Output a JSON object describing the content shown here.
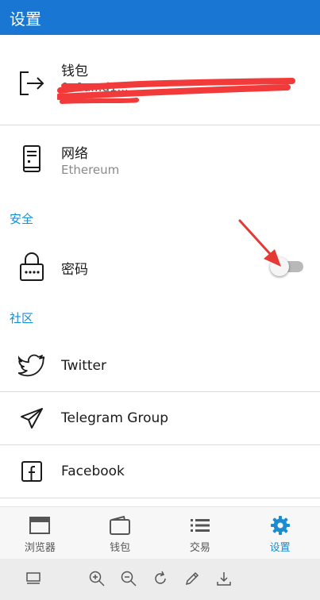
{
  "appbar": {
    "title": "设置"
  },
  "wallet": {
    "title": "钱包",
    "address_visible": "0x0a...d1..."
  },
  "network": {
    "title": "网络",
    "value": "Ethereum"
  },
  "security": {
    "header": "安全",
    "password_label": "密码",
    "password_enabled": false
  },
  "community": {
    "header": "社区",
    "items": [
      {
        "label": "Twitter",
        "icon": "twitter-icon"
      },
      {
        "label": "Telegram Group",
        "icon": "telegram-icon"
      },
      {
        "label": "Facebook",
        "icon": "facebook-icon"
      }
    ]
  },
  "bottom_nav": {
    "items": [
      {
        "label": "浏览器",
        "icon": "browser-icon",
        "active": false
      },
      {
        "label": "钱包",
        "icon": "wallet-icon",
        "active": false
      },
      {
        "label": "交易",
        "icon": "list-icon",
        "active": false
      },
      {
        "label": "设置",
        "icon": "gear-icon",
        "active": true
      }
    ]
  },
  "colors": {
    "primary": "#1976d2",
    "accent": "#1a8ccf",
    "redaction": "#f23a3a",
    "annotation_arrow": "#e53935"
  }
}
